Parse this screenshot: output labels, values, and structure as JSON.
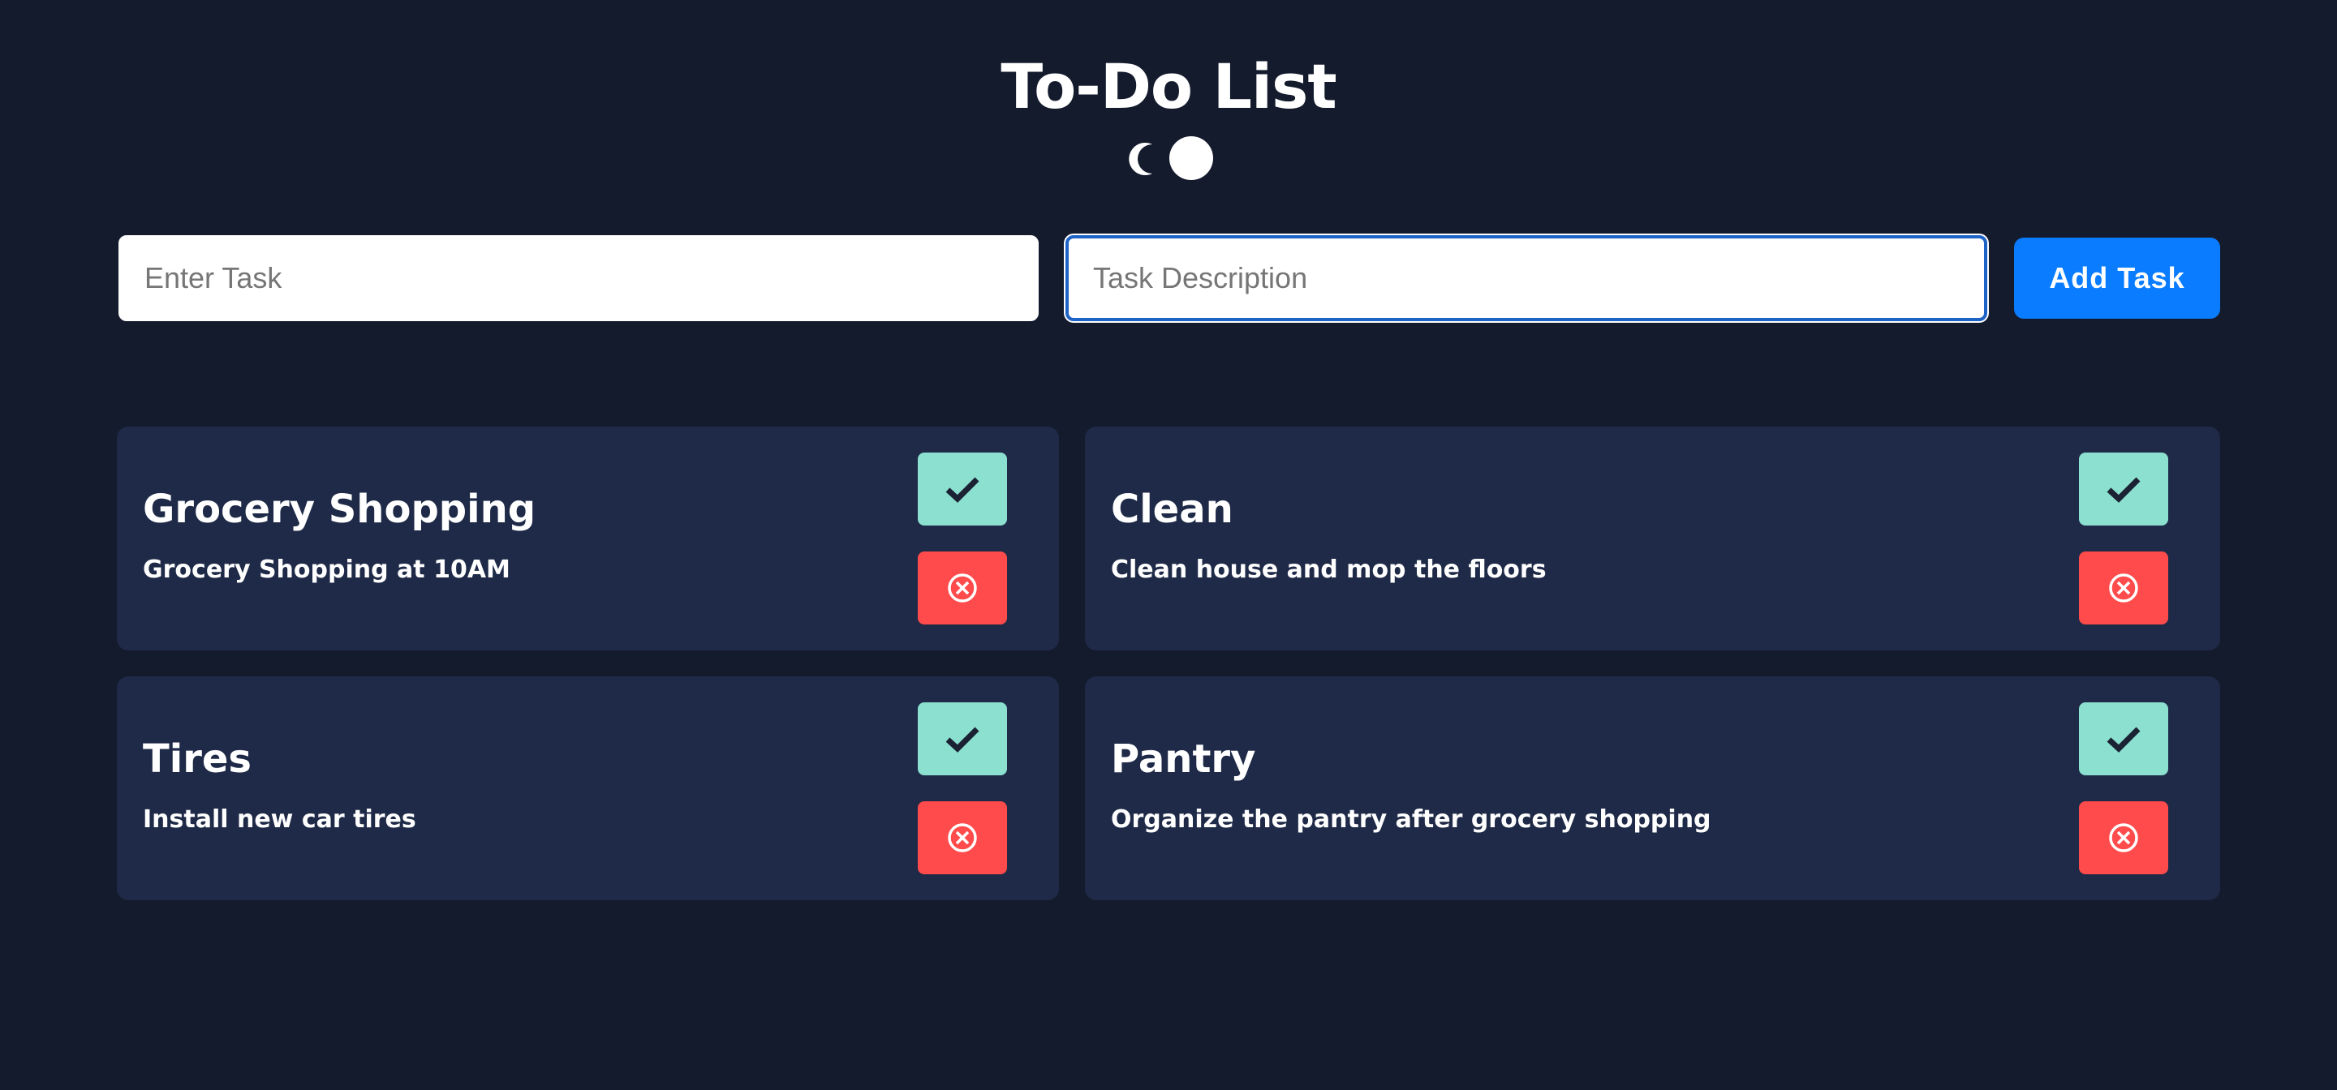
{
  "app": {
    "title": "To-Do List"
  },
  "theme_toggle": {
    "icon": "moon-icon",
    "knob_icon": "toggle-knob-icon"
  },
  "form": {
    "task_placeholder": "Enter Task",
    "task_value": "",
    "description_placeholder": "Task Description",
    "description_value": "",
    "add_button_label": "Add Task"
  },
  "tasks": [
    {
      "title": "Grocery Shopping",
      "description": "Grocery Shopping at 10AM"
    },
    {
      "title": "Clean",
      "description": "Clean house and mop the floors"
    },
    {
      "title": "Tires",
      "description": "Install new car tires"
    },
    {
      "title": "Pantry",
      "description": "Organize the pantry after grocery shopping"
    }
  ],
  "task_actions": {
    "complete_icon": "checkmark-icon",
    "delete_icon": "circle-x-icon"
  },
  "colors": {
    "background": "#141b2d",
    "card": "#1e2a47",
    "accent": "#0a7cff",
    "complete": "#8be0cf",
    "delete": "#ff4b4b",
    "text": "#ffffff"
  }
}
